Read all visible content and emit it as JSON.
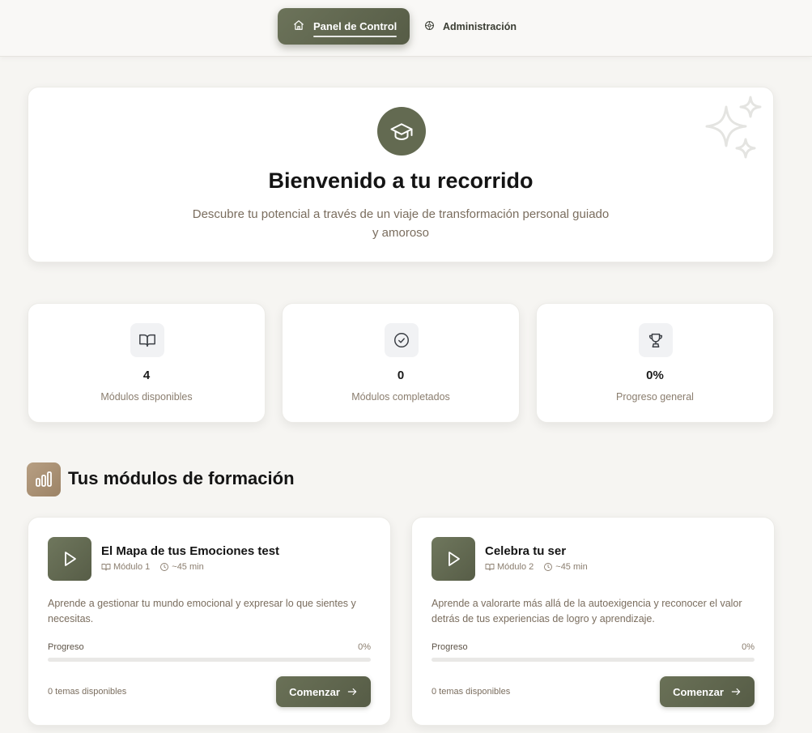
{
  "nav": {
    "items": [
      {
        "label": "Panel de Control",
        "icon": "home-icon",
        "active": true
      },
      {
        "label": "Administración",
        "icon": "settings-icon",
        "active": false
      }
    ]
  },
  "hero": {
    "icon": "graduation-cap-icon",
    "title": "Bienvenido a tu recorrido",
    "subtitle": "Descubre tu potencial a través de un viaje de transformación personal guiado y amoroso",
    "decoration": "sparkles-icon"
  },
  "stats": [
    {
      "icon": "book-open-icon",
      "value": "4",
      "label": "Módulos disponibles"
    },
    {
      "icon": "check-circle-icon",
      "value": "0",
      "label": "Módulos completados"
    },
    {
      "icon": "trophy-icon",
      "value": "0%",
      "label": "Progreso general"
    }
  ],
  "section": {
    "icon": "bar-chart-icon",
    "title": "Tus módulos de formación"
  },
  "modules": [
    {
      "title": "El Mapa de tus Emociones test",
      "module_label": "Módulo 1",
      "duration": "~45 min",
      "description": "Aprende a gestionar tu mundo emocional y expresar lo que sientes y necesitas.",
      "progress_label": "Progreso",
      "progress_text": "0%",
      "progress": 0,
      "topics": "0 temas disponibles",
      "button_label": "Comenzar"
    },
    {
      "title": "Celebra tu ser",
      "module_label": "Módulo 2",
      "duration": "~45 min",
      "description": "Aprende a valorarte más allá de la autoexigencia y reconocer el valor detrás de tus experiencias de logro y aprendizaje.",
      "progress_label": "Progreso",
      "progress_text": "0%",
      "progress": 0,
      "topics": "0 temas disponibles",
      "button_label": "Comenzar"
    }
  ],
  "colors": {
    "primary": "#636a51",
    "accent_brown": "#a88f72",
    "muted_text": "#7a6d5e",
    "background": "#f6f5f2"
  }
}
